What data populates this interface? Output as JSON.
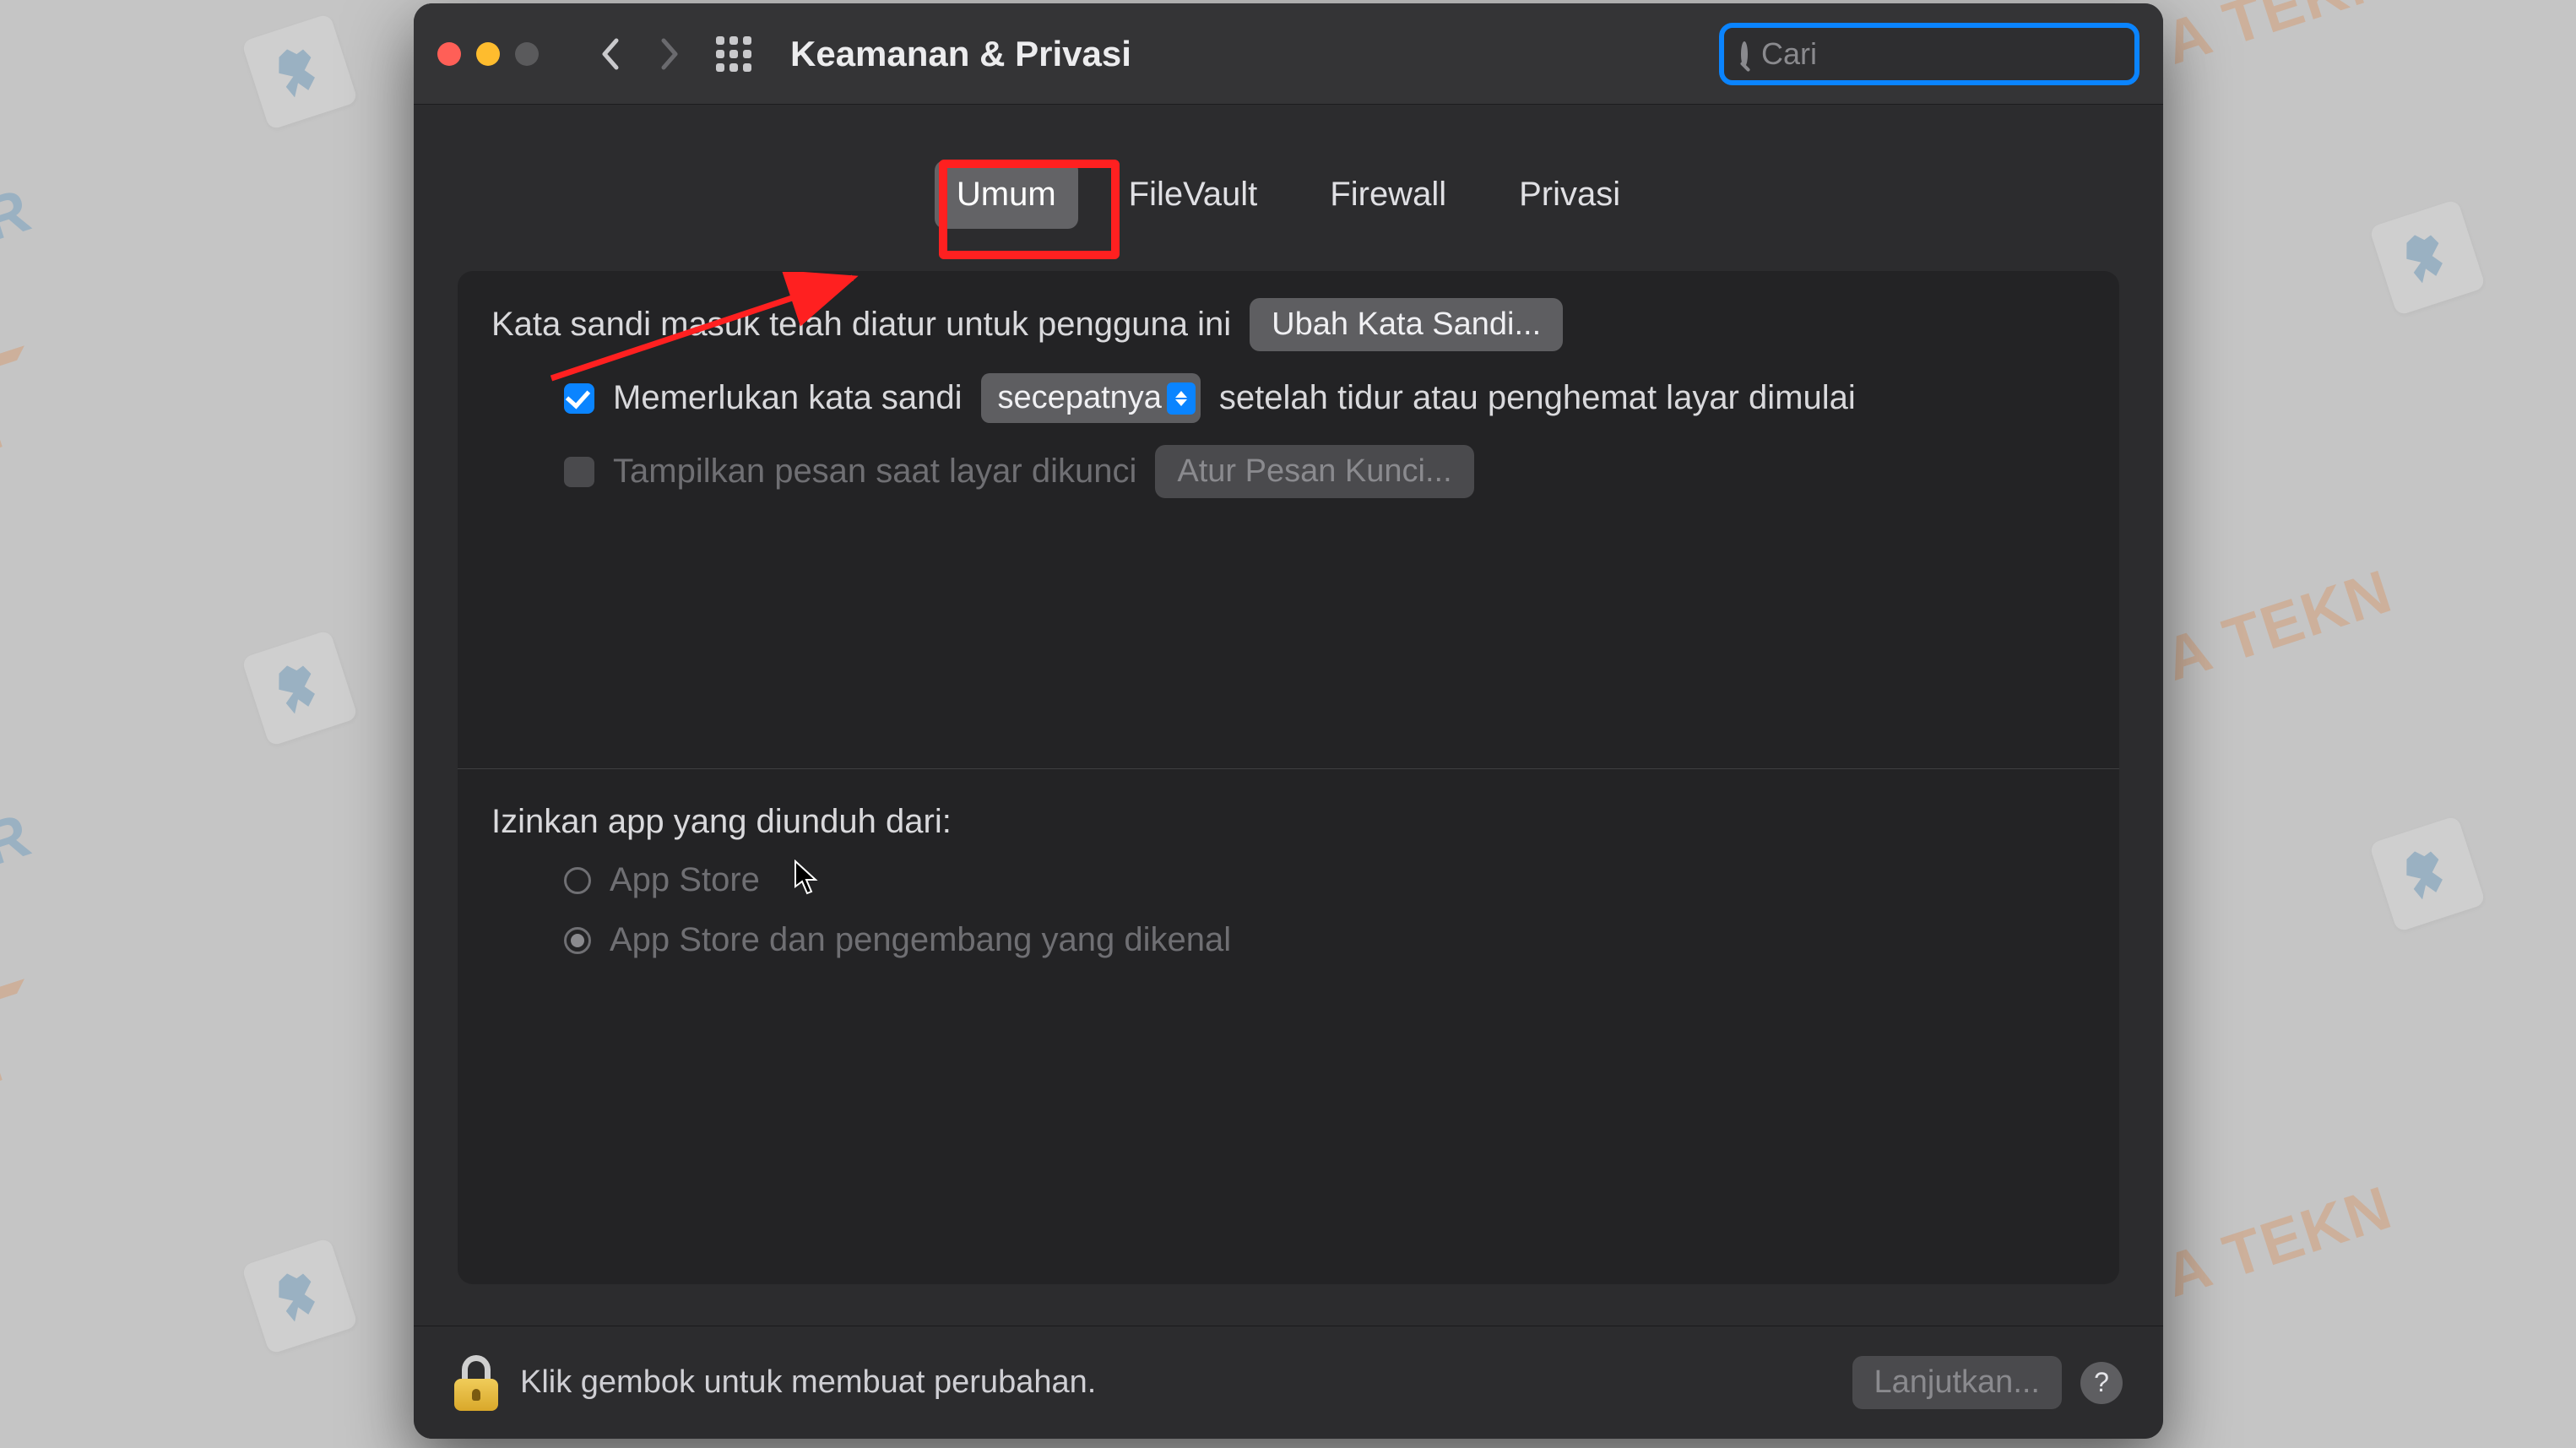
{
  "watermark_text_primary": "SUR",
  "watermark_text_secondary": "A TEKN",
  "titlebar": {
    "title": "Keamanan & Privasi"
  },
  "search": {
    "placeholder": "Cari"
  },
  "tabs": {
    "umum": "Umum",
    "filevault": "FileVault",
    "firewall": "Firewall",
    "privasi": "Privasi"
  },
  "general": {
    "login_password_set": "Kata sandi masuk telah diatur untuk pengguna ini",
    "change_password": "Ubah Kata Sandi...",
    "require_password": "Memerlukan kata sandi",
    "delay_value": "secepatnya",
    "after_sleep": "setelah tidur atau penghemat layar dimulai",
    "show_lock_message": "Tampilkan pesan saat layar dikunci",
    "set_lock_message": "Atur Pesan Kunci..."
  },
  "allow_apps": {
    "label": "Izinkan app yang diunduh dari:",
    "app_store": "App Store",
    "app_store_dev": "App Store dan pengembang yang dikenal"
  },
  "footer": {
    "lock_text": "Klik gembok untuk membuat perubahan.",
    "advanced": "Lanjutkan...",
    "help": "?"
  }
}
